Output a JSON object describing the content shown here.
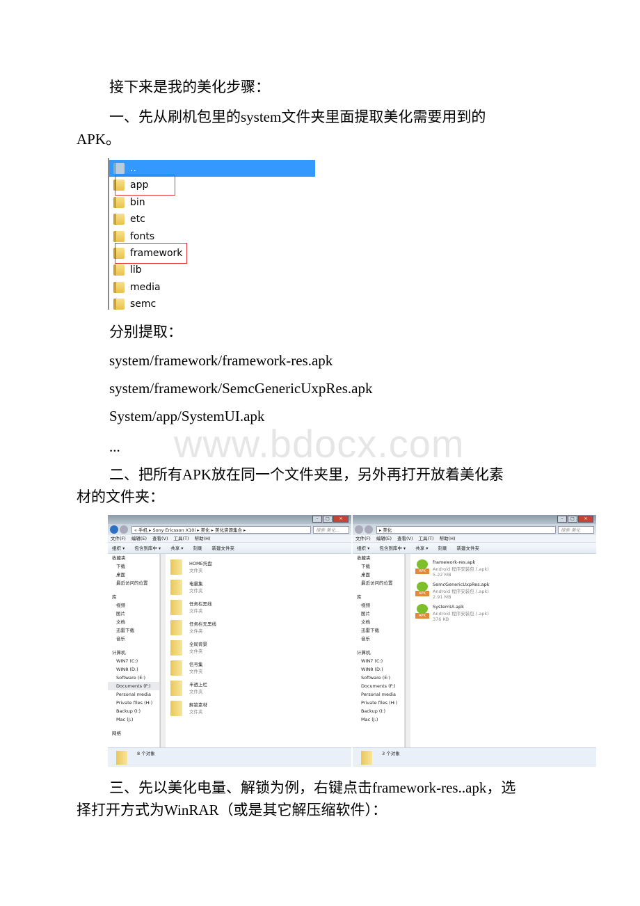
{
  "paragraphs": {
    "intro": "接下来是我的美化步骤：",
    "step1_a": "一、先从刷机包里的system文件夹里面提取美化需要用到的",
    "step1_b": "APK。",
    "extract": "分别提取：",
    "path1": "system/framework/framework-res.apk",
    "path2": "system/framework/SemcGenericUxpRes.apk",
    "path3": "System/app/SystemUI.apk",
    "ellipsis": "...",
    "step2_a": "二、把所有APK放在同一个文件夹里，另外再打开放着美化素",
    "step2_b": "材的文件夹：",
    "step3_a": "三、先以美化电量、解锁为例，右键点击framework-res..apk，选",
    "step3_b": "择打开方式为WinRAR（或是其它解压缩软件）："
  },
  "watermark": "www.bdocx.com",
  "folder_list": {
    "items": [
      "..",
      "app",
      "bin",
      "etc",
      "fonts",
      "framework",
      "lib",
      "media",
      "semc"
    ],
    "selected": "..",
    "highlighted": [
      "app",
      "framework"
    ],
    "highlight_color": "#e33333",
    "selection_color": "#3399ff"
  },
  "explorer_left": {
    "breadcrumb": "« 手机 ▸ Sony Ericsson X10i ▸ 美化 ▸ 美化资源集合 ▸",
    "search_placeholder": "搜索 美化...",
    "menu": [
      "文件(F)",
      "编辑(E)",
      "查看(V)",
      "工具(T)",
      "帮助(H)"
    ],
    "toolbar": [
      "组织 ▾",
      "包含到库中 ▾",
      "共享 ▾",
      "刻录",
      "新建文件夹"
    ],
    "sidebar": [
      "收藏夹",
      "下载",
      "桌面",
      "最近访问的位置",
      "库",
      "视频",
      "图片",
      "文档",
      "迅雷下载",
      "音乐",
      "计算机",
      "WIN7 (C:)",
      "WIN8 (D:)",
      "Software (E:)",
      "Documents (F:)",
      "Personal media",
      "Private files (H:)",
      "Backup (I:)",
      "Mac (J:)",
      "网络"
    ],
    "files": [
      {
        "name": "HOME托盘",
        "type": "文件夹"
      },
      {
        "name": "电量集",
        "type": "文件夹"
      },
      {
        "name": "任务栏黑线",
        "type": "文件夹"
      },
      {
        "name": "任务栏无黑线",
        "type": "文件夹"
      },
      {
        "name": "全局背景",
        "type": "文件夹"
      },
      {
        "name": "信号集",
        "type": "文件夹"
      },
      {
        "name": "半透上栏",
        "type": "文件夹"
      },
      {
        "name": "解锁素材",
        "type": "文件夹"
      }
    ],
    "status": "8 个对象"
  },
  "explorer_right": {
    "breadcrumb": "▸ 美化",
    "search_placeholder": "搜索 美化",
    "menu": [
      "文件(F)",
      "编辑(E)",
      "查看(V)",
      "工具(T)",
      "帮助(H)"
    ],
    "toolbar": [
      "组织 ▾",
      "包含到库中 ▾",
      "共享 ▾",
      "刻录",
      "新建文件夹"
    ],
    "sidebar": [
      "收藏夹",
      "下载",
      "桌面",
      "最近访问的位置",
      "库",
      "视频",
      "图片",
      "文档",
      "迅雷下载",
      "音乐",
      "计算机",
      "WIN7 (C:)",
      "WIN8 (D:)",
      "Software (E:)",
      "Documents (F:)",
      "Personal media",
      "Private files (H:)",
      "Backup (I:)",
      "Mac (J:)"
    ],
    "files": [
      {
        "name": "framework-res.apk",
        "type": "Android 程序安装包 (.apk)",
        "size": "5.22 MB"
      },
      {
        "name": "SemcGenericUxpRes.apk",
        "type": "Android 程序安装包 (.apk)",
        "size": "2.91 MB"
      },
      {
        "name": "SystemUI.apk",
        "type": "Android 程序安装包 (.apk)",
        "size": "376 KB"
      }
    ],
    "status": "3 个对象",
    "apk_badge": "APK"
  }
}
